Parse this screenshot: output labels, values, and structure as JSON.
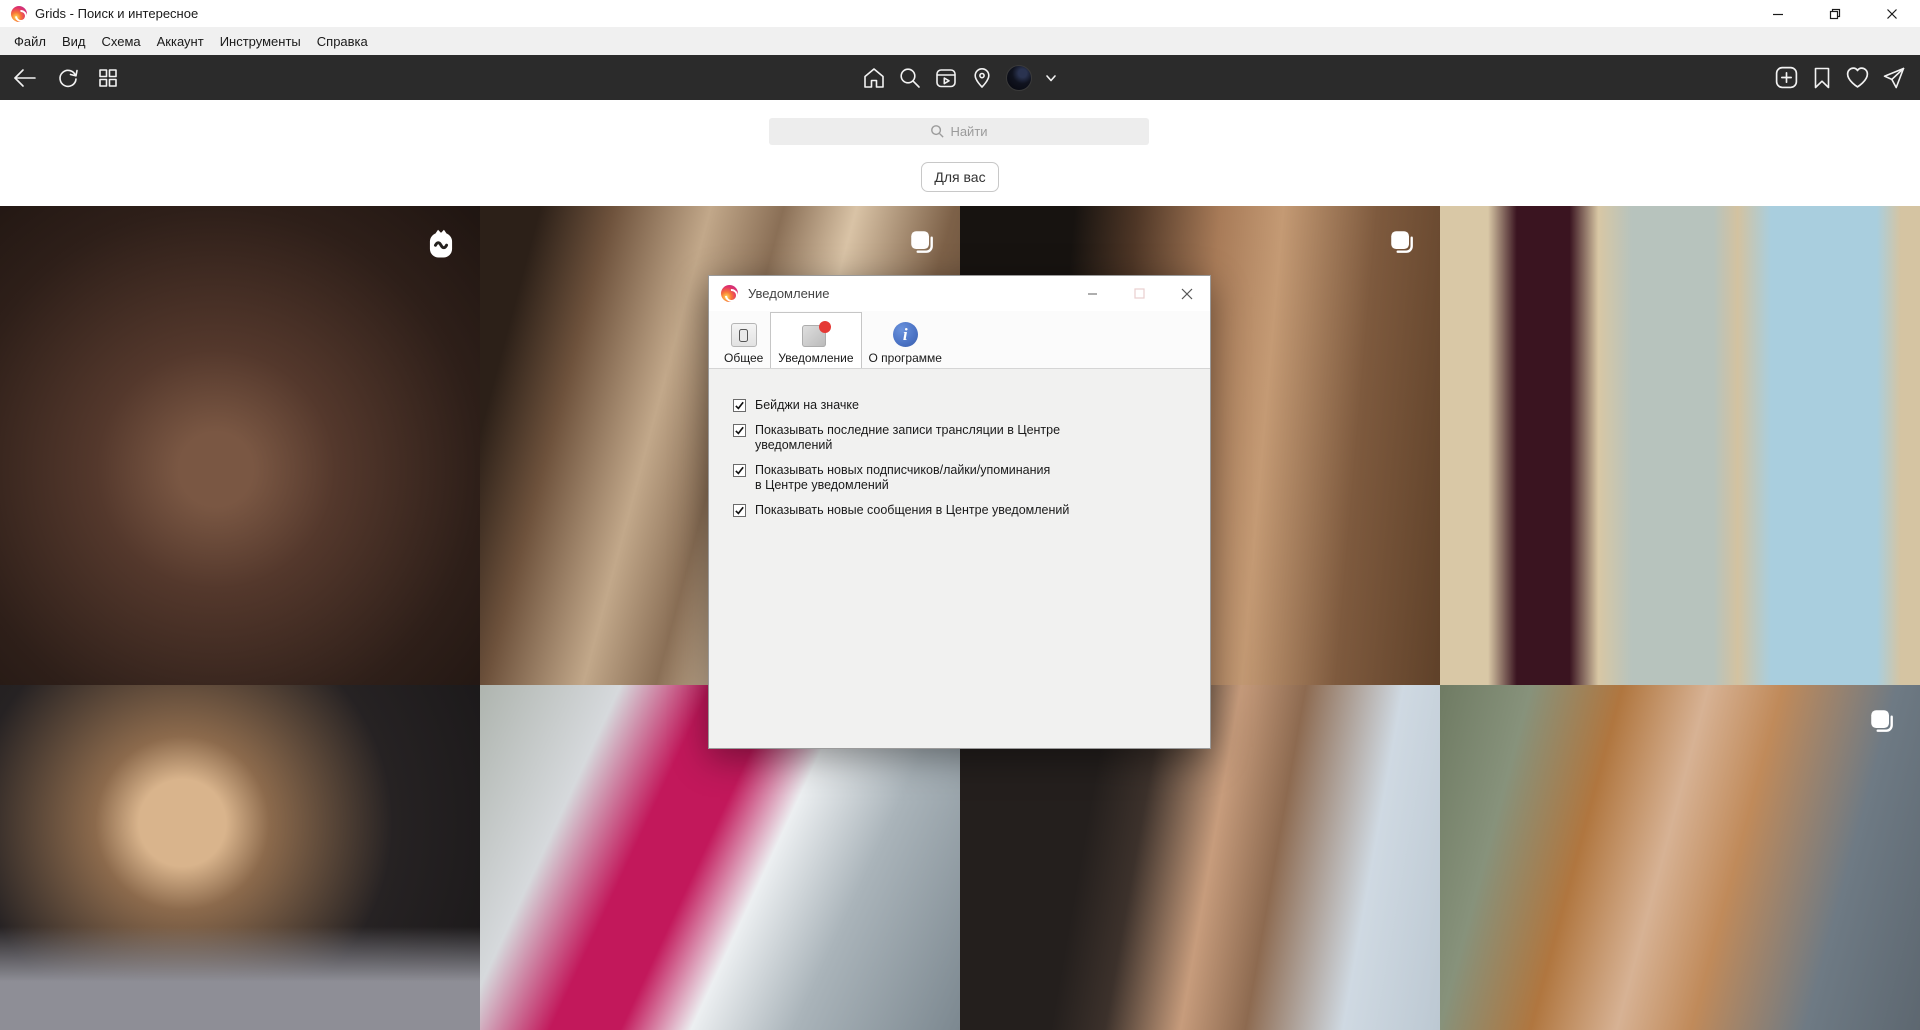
{
  "window": {
    "title": "Grids - Поиск и интересное",
    "controls": [
      "minimize-icon",
      "restore-icon",
      "close-icon"
    ]
  },
  "menu": {
    "items": [
      "Файл",
      "Вид",
      "Схема",
      "Аккаунт",
      "Инструменты",
      "Справка"
    ]
  },
  "toolbar": {
    "left_icons": [
      "back-icon",
      "refresh-icon",
      "grid-view-icon"
    ],
    "center_icons": [
      "home-icon",
      "search-icon",
      "igtv-icon",
      "location-icon",
      "avatar",
      "chevron-down-icon"
    ],
    "right_icons": [
      "new-post-icon",
      "bookmark-icon",
      "heart-icon",
      "direct-icon"
    ]
  },
  "search": {
    "placeholder": "Найти"
  },
  "feed": {
    "filter_button": "Для вас",
    "tiles": [
      {
        "name": "photo-man-smoking-sepia",
        "badge": "igtv"
      },
      {
        "name": "photo-blonde-woman-interior",
        "badge": "album"
      },
      {
        "name": "photo-model-beige-bodysuit",
        "badge": "album"
      },
      {
        "name": "photo-three-actresses-premiere",
        "badge": null
      },
      {
        "name": "photo-blonde-woman-sparkly-top",
        "badge": null
      },
      {
        "name": "photo-woman-pink-jacket-stairs",
        "badge": null
      },
      {
        "name": "photo-brunette-woman-window",
        "badge": null
      },
      {
        "name": "photo-redhead-woman-street",
        "badge": "album"
      }
    ]
  },
  "dialog": {
    "title": "Уведомление",
    "controls": [
      "minimize-icon",
      "maximize-icon-disabled",
      "close-icon"
    ],
    "tabs": [
      {
        "label": "Общее",
        "icon": "general-settings-icon",
        "active": false
      },
      {
        "label": "Уведомление",
        "icon": "notification-badge-icon",
        "active": true
      },
      {
        "label": "О программе",
        "icon": "about-info-icon",
        "active": false
      }
    ],
    "checkboxes": [
      {
        "label": "Бейджи на значке",
        "checked": true
      },
      {
        "label": "Показывать последние записи трансляции в Центре\nуведомлений",
        "checked": true
      },
      {
        "label": "Показывать новых подписчиков/лайки/упоминания\nв Центре уведомлений",
        "checked": true
      },
      {
        "label": "Показывать новые сообщения в Центре уведомлений",
        "checked": true
      }
    ]
  },
  "colors": {
    "toolbar_bg": "#2b2b2b",
    "menubar_bg": "#f0f0f0",
    "dialog_bg": "#f1f1f0",
    "notification_badge_red": "#e53935",
    "about_icon_blue": "#4a72c4",
    "logo_gradient": [
      "#feda75",
      "#f77737",
      "#e1306c",
      "#c13584",
      "#833ab4"
    ]
  }
}
